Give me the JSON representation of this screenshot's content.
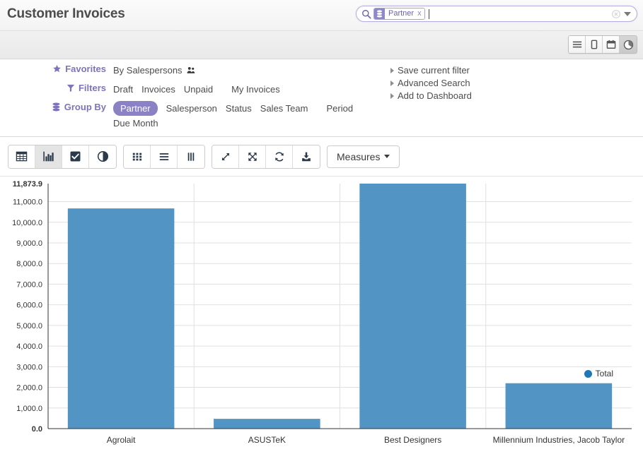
{
  "header": {
    "title": "Customer Invoices"
  },
  "search": {
    "icon": "search-icon",
    "facet": {
      "icon": "group-by-icon",
      "label": "Partner",
      "close": "x"
    },
    "value": "",
    "placeholder": "",
    "clear_icon": "clear-icon",
    "dropdown_icon": "chevron-down-icon"
  },
  "view_switcher": {
    "views": [
      {
        "name": "list-view",
        "icon": "list-icon",
        "active": false
      },
      {
        "name": "form-view",
        "icon": "form-icon",
        "active": false
      },
      {
        "name": "calendar-view",
        "icon": "calendar-icon",
        "active": false
      },
      {
        "name": "graph-view",
        "icon": "pie-chart-icon",
        "active": true
      }
    ]
  },
  "search_panel": {
    "favorites": {
      "label": "Favorites",
      "icon": "star-icon",
      "items": [
        {
          "label": "By Salespersons",
          "icon": "people-icon"
        }
      ]
    },
    "filters": {
      "label": "Filters",
      "icon": "filter-icon",
      "items": [
        {
          "label": "Draft"
        },
        {
          "label": "Invoices"
        },
        {
          "label": "Unpaid"
        },
        {
          "label": "My Invoices"
        }
      ]
    },
    "group_by": {
      "label": "Group By",
      "icon": "group-by-icon",
      "items": [
        {
          "label": "Partner",
          "selected": true
        },
        {
          "label": "Salesperson",
          "selected": false
        },
        {
          "label": "Status",
          "selected": false
        },
        {
          "label": "Sales Team",
          "selected": false
        },
        {
          "label": "Period",
          "selected": false
        },
        {
          "label": "Due Month",
          "selected": false
        }
      ]
    },
    "actions": [
      {
        "label": "Save current filter"
      },
      {
        "label": "Advanced Search"
      },
      {
        "label": "Add to Dashboard"
      }
    ]
  },
  "chart_toolbar": {
    "group_chart_types": [
      {
        "name": "pivot-table-button",
        "icon": "table-icon",
        "active": false
      },
      {
        "name": "bar-chart-button",
        "icon": "bar-chart-icon",
        "active": true
      },
      {
        "name": "line-chart-button",
        "icon": "checkbox-icon",
        "active": false
      },
      {
        "name": "pie-chart-button",
        "icon": "half-circle-icon",
        "active": false
      }
    ],
    "group_layout": [
      {
        "name": "grid-button",
        "icon": "grid-icon",
        "active": false
      },
      {
        "name": "rows-button",
        "icon": "rows-icon",
        "active": false
      },
      {
        "name": "columns-button",
        "icon": "columns-icon",
        "active": false
      }
    ],
    "group_actions": [
      {
        "name": "expand-button",
        "icon": "expand-diagonal-icon",
        "active": false
      },
      {
        "name": "fold-all-button",
        "icon": "arrows-out-icon",
        "active": false
      },
      {
        "name": "refresh-button",
        "icon": "refresh-icon",
        "active": false
      },
      {
        "name": "download-button",
        "icon": "download-icon",
        "active": false
      }
    ],
    "measures": {
      "label": "Measures",
      "caret_icon": "chevron-down-icon"
    }
  },
  "chart_data": {
    "type": "bar",
    "title": "",
    "xlabel": "",
    "ylabel": "",
    "categories": [
      "Agrolait",
      "ASUSTeK",
      "Best Designers",
      "Millennium Industries, Jacob Taylor"
    ],
    "series": [
      {
        "name": "Total",
        "color": "#5295c4",
        "values": [
          10670.0,
          475.0,
          11873.9,
          2200.0
        ]
      }
    ],
    "ylim": [
      0,
      11873.9
    ],
    "ytick_labels": [
      "11,873.9",
      "11,000.0",
      "10,000.0",
      "9,000.0",
      "8,000.0",
      "7,000.0",
      "6,000.0",
      "5,000.0",
      "4,000.0",
      "3,000.0",
      "2,000.0",
      "1,000.0",
      "0.0"
    ],
    "ytick_values": [
      11873.9,
      11000,
      10000,
      9000,
      8000,
      7000,
      6000,
      5000,
      4000,
      3000,
      2000,
      1000,
      0
    ],
    "legend": [
      {
        "label": "Total",
        "color": "#1f77b4"
      }
    ],
    "legend_position": "top-right",
    "grid": true
  }
}
